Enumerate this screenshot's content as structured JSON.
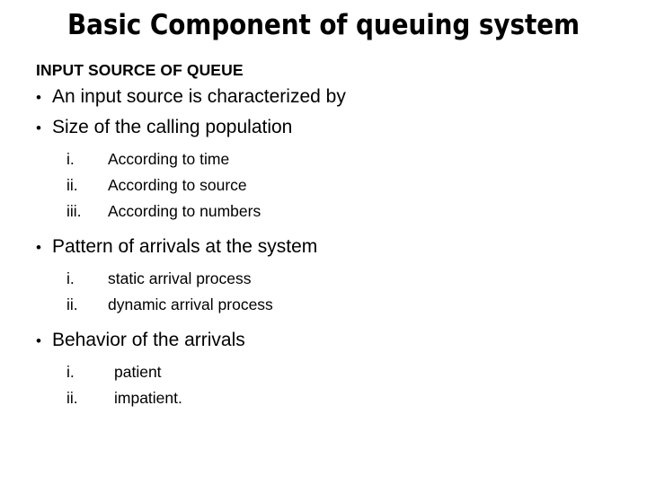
{
  "slide": {
    "title": "Basic Component of queuing system",
    "heading": "INPUT SOURCE OF QUEUE",
    "bullet_glyph": "•",
    "sections": [
      {
        "bullet": "An input source is characterized by",
        "subitems": []
      },
      {
        "bullet": "Size of the calling population",
        "subitems": [
          {
            "marker": "i.",
            "text": "According to time"
          },
          {
            "marker": "ii.",
            "text": "According to source"
          },
          {
            "marker": "iii.",
            "text": "According to numbers"
          }
        ]
      },
      {
        "bullet": "Pattern of arrivals at the system",
        "subitems": [
          {
            "marker": "i.",
            "text": "static arrival process"
          },
          {
            "marker": "ii.",
            "text": "dynamic arrival process"
          }
        ]
      },
      {
        "bullet": "Behavior of the arrivals",
        "subitems": [
          {
            "marker": "i.",
            "text": "patient"
          },
          {
            "marker": "ii.",
            "text": "impatient."
          }
        ]
      }
    ]
  },
  "colors": {
    "background": "#ffffff",
    "text": "#000000"
  }
}
